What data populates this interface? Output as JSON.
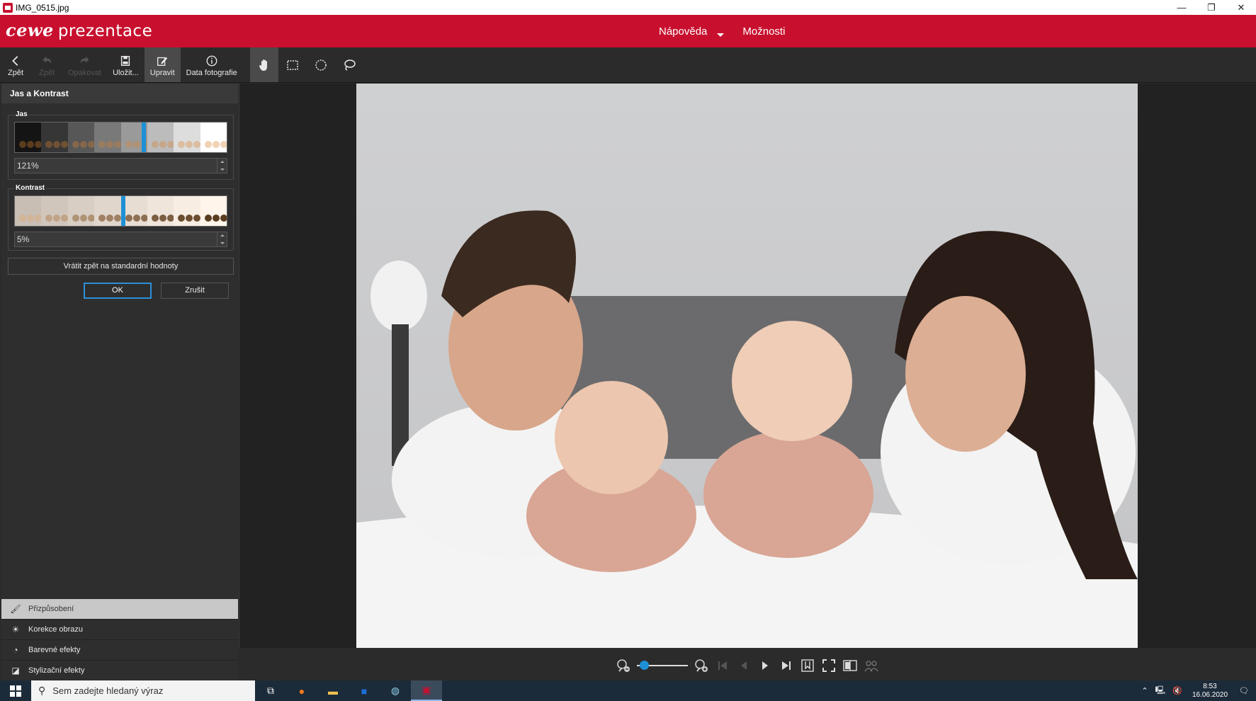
{
  "window": {
    "title": "IMG_0515.jpg",
    "minimize": "—",
    "restore": "❐",
    "close": "✕"
  },
  "brand": {
    "part1": "cewe",
    "part2": "prezentace"
  },
  "menu": {
    "help": "Nápověda",
    "options": "Možnosti"
  },
  "toolbar": {
    "back": "Zpět",
    "undo": "Zpět",
    "redo": "Opakovat",
    "save": "Uložit...",
    "edit": "Upravit",
    "photo_data": "Data fotografie"
  },
  "panel": {
    "title": "Jas a Kontrast",
    "brightness": {
      "label": "Jas",
      "value": "121%",
      "marker_fraction": 0.6
    },
    "contrast": {
      "label": "Kontrast",
      "value": "5%",
      "marker_fraction": 0.5
    },
    "reset": "Vrátit zpět na standardní hodnoty",
    "ok": "OK",
    "cancel": "Zrušit"
  },
  "accordion": [
    {
      "label": "Přizpůsobení",
      "icon": "brush-icon",
      "active": true
    },
    {
      "label": "Korekce obrazu",
      "icon": "sun-icon",
      "active": false
    },
    {
      "label": "Barevné efekty",
      "icon": "palette-icon",
      "active": false
    },
    {
      "label": "Stylizační efekty",
      "icon": "style-icon",
      "active": false
    }
  ],
  "zoom": {
    "level_fraction": 0.05
  },
  "taskbar": {
    "search_placeholder": "Sem zadejte hledaný výraz",
    "time": "8:53",
    "date": "16.06.2020"
  },
  "colors": {
    "brand_red": "#c8102e",
    "accent_blue": "#1e90d6"
  }
}
